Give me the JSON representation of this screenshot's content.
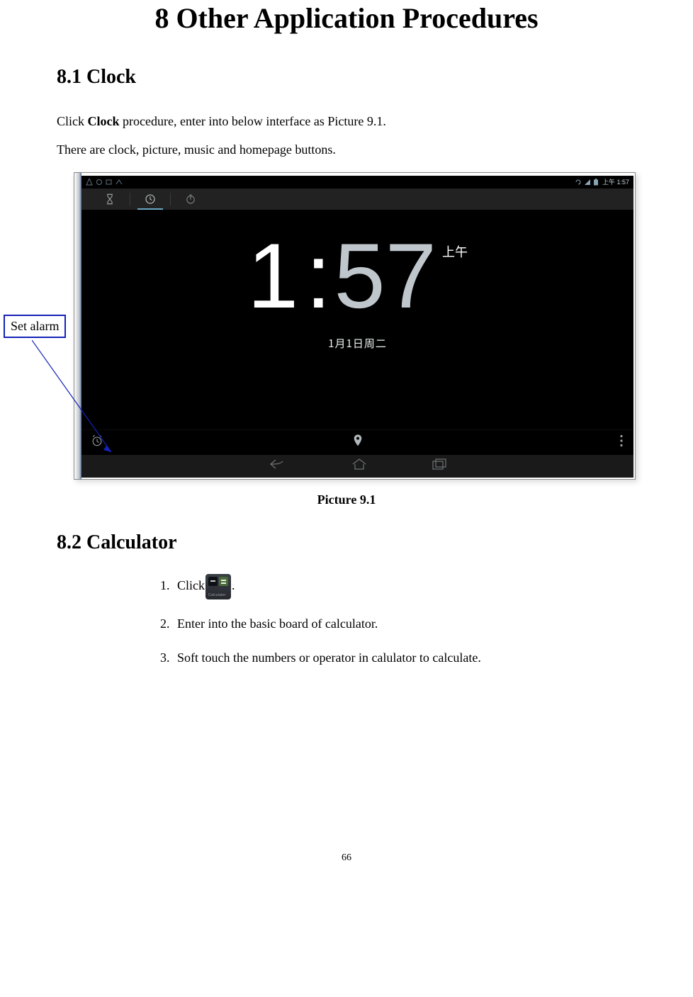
{
  "chapter_title": "8 Other Application Procedures",
  "section_81_title": "8.1 Clock",
  "section_81_para1_a": "Click ",
  "section_81_para1_b": "Clock",
  "section_81_para1_c": " procedure, enter into below interface as Picture 9.1.",
  "section_81_para2": "There are clock, picture, music and homepage buttons.",
  "callout_label": "Set alarm",
  "figure_caption": "Picture 9.1",
  "screenshot": {
    "status_time": "上午 1:57",
    "clock_hour": "1",
    "clock_colon": ":",
    "clock_minute": "57",
    "clock_ampm": "上午",
    "clock_date": "1月1日周二"
  },
  "section_82_title": "8.2 Calculator",
  "calc_icon_label": "Calculator",
  "steps": {
    "1a": "Click",
    "1b": ".",
    "2": "Enter into the basic board of calculator.",
    "3": "Soft touch the numbers or operator in calulator to calculate."
  },
  "page_number": "66"
}
